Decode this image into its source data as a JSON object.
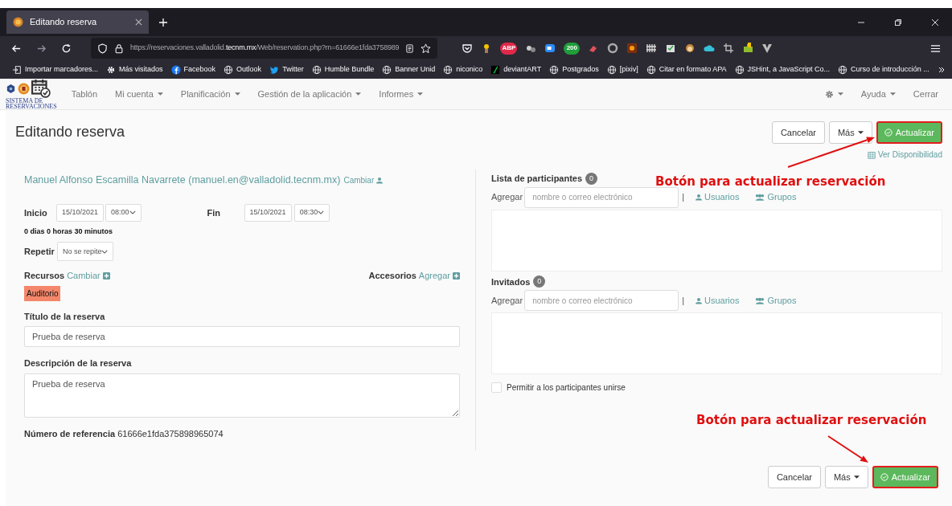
{
  "browser": {
    "tab": {
      "title": "Editando reserva",
      "selected": true
    },
    "url": {
      "prefix": "https://reservaciones.valladolid.",
      "domain": "tecnm.mx",
      "path": "/Web/reservation.php?rn=61666e1fda3758989"
    },
    "extensions": [
      {
        "kind": "pocket"
      },
      {
        "kind": "miner"
      },
      {
        "kind": "abp",
        "label": "ABP"
      },
      {
        "kind": "dots"
      },
      {
        "kind": "camera"
      },
      {
        "kind": "shield",
        "label": "200"
      },
      {
        "kind": "eraser"
      },
      {
        "kind": "ring"
      },
      {
        "kind": "sun"
      },
      {
        "kind": "fence"
      },
      {
        "kind": "clip"
      },
      {
        "kind": "monkey"
      },
      {
        "kind": "cloud"
      },
      {
        "kind": "crop"
      },
      {
        "kind": "puzzle"
      },
      {
        "kind": "vee"
      }
    ],
    "bookmarks": [
      {
        "kind": "import",
        "label": "Importar marcadores..."
      },
      {
        "kind": "gear",
        "label": "Más visitados"
      },
      {
        "kind": "facebook",
        "label": "Facebook"
      },
      {
        "kind": "globe",
        "label": "Outlook"
      },
      {
        "kind": "twitter",
        "label": "Twitter"
      },
      {
        "kind": "globe",
        "label": "Humble Bundle"
      },
      {
        "kind": "globe",
        "label": "Banner Unid"
      },
      {
        "kind": "globe",
        "label": "niconico"
      },
      {
        "kind": "deviant",
        "label": "deviantART"
      },
      {
        "kind": "globe",
        "label": "Postgrados"
      },
      {
        "kind": "globe",
        "label": "[pixiv]"
      },
      {
        "kind": "globe",
        "label": "Citar en formato APA"
      },
      {
        "kind": "globe",
        "label": "JSHint, a JavaScript Co..."
      },
      {
        "kind": "globe",
        "label": "Curso de introducción ..."
      }
    ]
  },
  "navbar": {
    "logo_text": [
      "SISTEMA DE",
      "RESERVACIONES"
    ],
    "items": [
      {
        "label": "Tablón",
        "dropdown": false
      },
      {
        "label": "Mi cuenta",
        "dropdown": true
      },
      {
        "label": "Planificación",
        "dropdown": true
      },
      {
        "label": "Gestión de la aplicación",
        "dropdown": true
      },
      {
        "label": "Informes",
        "dropdown": true
      }
    ],
    "right": [
      {
        "label": "Ayuda",
        "dropdown": true
      },
      {
        "label": "Cerrar",
        "dropdown": false
      }
    ]
  },
  "page": {
    "title": "Editando reserva",
    "buttons": [
      "Cancelar",
      "Más",
      "Actualizar"
    ],
    "bottom_buttons": [
      "Cancelar",
      "Más",
      "Actualizar"
    ],
    "availability_link": "Ver Disponibilidad",
    "owner": "Manuel Alfonso Escamilla Navarrete (manuel.en@valladolid.tecnm.mx)",
    "owner_change": "Cambiar",
    "start": {
      "label": "Inicio",
      "date": "15/10/2021",
      "time": "08:00"
    },
    "end": {
      "label": "Fin",
      "date": "15/10/2021",
      "time": "08:30"
    },
    "duration": "0 dias 0 horas 30 minutos",
    "repeat": {
      "label": "Repetir",
      "value": "No se repite"
    },
    "resources": {
      "label": "Recursos",
      "link": "Cambiar",
      "items": [
        {
          "label": "Auditorio",
          "color": "#f4876b"
        }
      ]
    },
    "accessories": {
      "label": "Accesorios",
      "link": "Agregar"
    },
    "title_field": {
      "label": "Título de la reserva",
      "value": "Prueba de reserva"
    },
    "description": {
      "label": "Descripción de la reserva",
      "value": "Prueba de reserva"
    },
    "reference": {
      "label": "Número de referencia",
      "value": "61666e1fda375898965074"
    },
    "participants": {
      "label": "Lista de participantes",
      "count": "0",
      "add": "Agregar",
      "placeholder": "nombre o correo electrónico",
      "separator": "|",
      "users": "Usuarios",
      "groups": "Grupos"
    },
    "invitees": {
      "label": "Invitados",
      "count": "0",
      "add": "Agregar",
      "placeholder": "nombre o correo electrónico",
      "separator": "|",
      "users": "Usuarios",
      "groups": "Grupos"
    },
    "allow_join": {
      "label": "Permitir a los participantes unirse",
      "checked": false
    }
  },
  "annotations": [
    "Botón para actualizar reservación",
    "Botón para actualizar reservación"
  ]
}
